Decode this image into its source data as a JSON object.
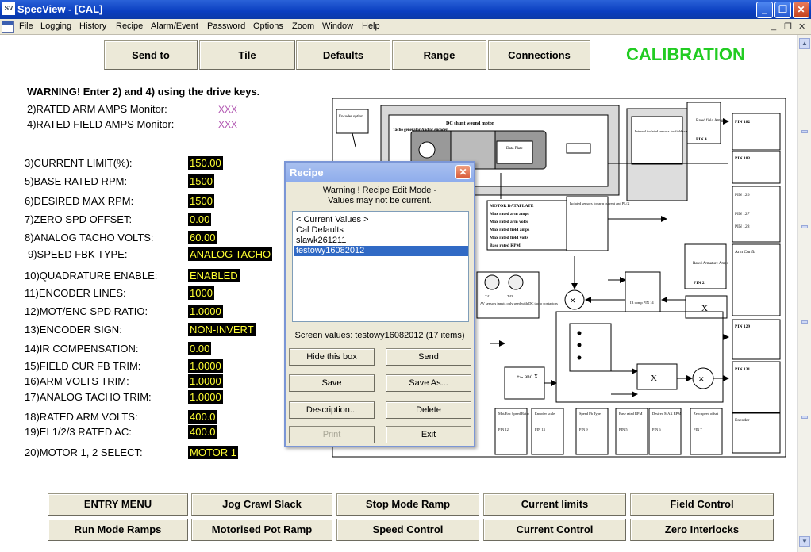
{
  "window": {
    "title": "SpecView - [CAL]",
    "app_icon_text": "SV"
  },
  "menu": [
    "File",
    "Logging",
    "History",
    "Recipe",
    "Alarm/Event",
    "Password",
    "Options",
    "Zoom",
    "Window",
    "Help"
  ],
  "top_buttons": [
    "Send to",
    "Tile",
    "Defaults",
    "Range",
    "Connections"
  ],
  "page_title": "CALIBRATION",
  "warning": "WARNING! Enter 2) and 4) using the drive keys.",
  "monitors": [
    {
      "label": "2)RATED ARM AMPS Monitor:",
      "value": "XXX"
    },
    {
      "label": "4)RATED FIELD AMPS Monitor:",
      "value": "XXX"
    }
  ],
  "params": [
    {
      "label": "3)CURRENT LIMIT(%):",
      "value": "150.00"
    },
    {
      "label": "5)BASE RATED RPM:",
      "value": "1500"
    },
    {
      "label": "6)DESIRED MAX RPM:",
      "value": "1500"
    },
    {
      "label": "7)ZERO SPD OFFSET:",
      "value": "0.00"
    },
    {
      "label": "8)ANALOG TACHO VOLTS:",
      "value": "60.00"
    },
    {
      "label": "9)SPEED FBK TYPE:",
      "value": "ANALOG TACHO"
    },
    {
      "label": "10)QUADRATURE ENABLE:",
      "value": "ENABLED"
    },
    {
      "label": "11)ENCODER LINES:",
      "value": "1000"
    },
    {
      "label": "12)MOT/ENC SPD RATIO:",
      "value": "1.0000"
    },
    {
      "label": "13)ENCODER SIGN:",
      "value": "NON-INVERT"
    },
    {
      "label": "14)IR COMPENSATION:",
      "value": "0.00"
    },
    {
      "label": "15)FIELD CUR FB TRIM:",
      "value": "1.0000"
    },
    {
      "label": "16)ARM VOLTS TRIM:",
      "value": "1.0000"
    },
    {
      "label": "17)ANALOG TACHO TRIM:",
      "value": "1.0000"
    },
    {
      "label": "18)RATED ARM VOLTS:",
      "value": "400.0"
    },
    {
      "label": "19)EL1/2/3 RATED AC:",
      "value": "400.0"
    },
    {
      "label": "20)MOTOR 1, 2 SELECT:",
      "value": "MOTOR 1"
    }
  ],
  "bottom_buttons": [
    [
      "ENTRY MENU",
      "Jog Crawl Slack",
      "Stop Mode Ramp",
      "Current limits",
      "Field Control"
    ],
    [
      "Run Mode Ramps",
      "Motorised Pot Ramp",
      "Speed Control",
      "Current Control",
      "Zero Interlocks"
    ]
  ],
  "diagram": {
    "encoder": "Encoder option",
    "tacho": "Tacho generator And/or encoder",
    "motor": "DC shunt wound motor",
    "data_plate": "Data Plate",
    "dataplate_box": [
      "MOTOR DATAPLATE",
      "Max rated arm amps",
      "Max rated arm volts",
      "Max rated field amps",
      "Max rated field volts",
      "Base rated RPM"
    ],
    "isolated_field": "Internal isolated sensors for field current",
    "isolated_arm": "Isolated sensors for arm current and PL/X",
    "rated_field": "Rated field Amps",
    "rated_field_pin": "PIN 4",
    "rated_arm": "Rated Armature Amps",
    "rated_arm_pin": "PIN 2",
    "ir_comp": "IR comp PIN 14",
    "analog_tacho": "AV sensors inputs only used with DC tacho contactors",
    "t41": "T41",
    "t43": "T43",
    "right_pins": [
      "PIN 182",
      "PIN 183",
      "PIN 126",
      "PIN 127",
      "PIN 128",
      "Arm Cur fb",
      "PIN 129",
      "PIN 131",
      "Encoder"
    ],
    "bottom_boxes": [
      {
        "t": "Mot/Enc Speed Ratio",
        "p": "PIN 12"
      },
      {
        "t": "Encoder scale",
        "p": "PIN 13"
      },
      {
        "t": "Speed Fb Type",
        "p": "PIN 9"
      },
      {
        "t": "Base rated RPM",
        "p": "PIN 5"
      },
      {
        "t": "Desired MAX RPM",
        "p": "PIN 6"
      },
      {
        "t": "Zero speed offset",
        "p": "PIN 7"
      }
    ],
    "plusminus": "+/- and X",
    "mult": "X"
  },
  "dialog": {
    "title": "Recipe",
    "msg1": "Warning ! Recipe Edit Mode -",
    "msg2": "Values may not be current.",
    "items": [
      "< Current Values >",
      "Cal Defaults",
      "slawk261211",
      "testowy16082012"
    ],
    "selected": 3,
    "screen_values": "Screen values: testowy16082012 (17 items)",
    "buttons": [
      [
        "Hide this box",
        "Send"
      ],
      [
        "Save",
        "Save As..."
      ],
      [
        "Description...",
        "Delete"
      ],
      [
        "Print",
        "Exit"
      ]
    ]
  }
}
